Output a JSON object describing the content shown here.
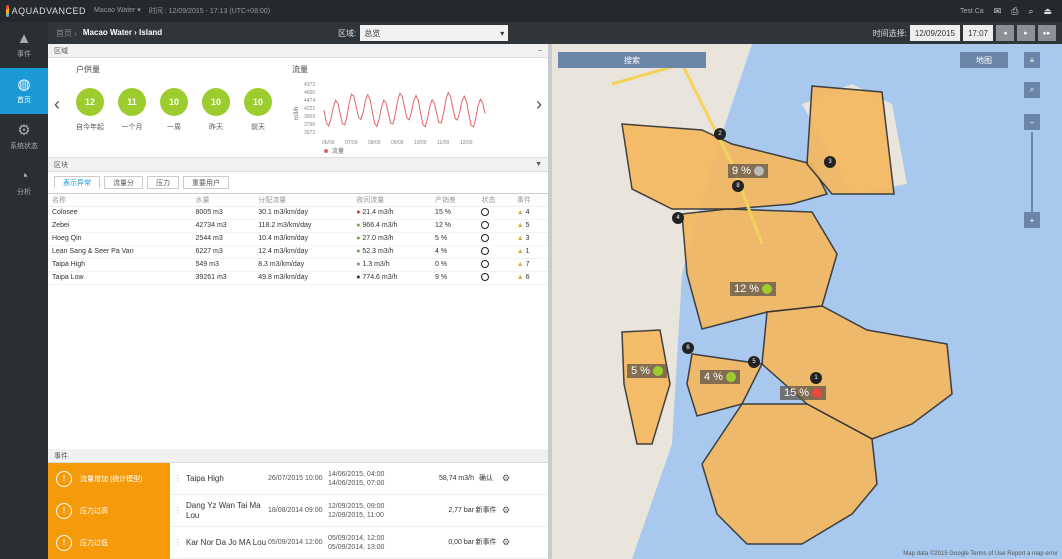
{
  "topbar": {
    "brand": "AQUADVANCED",
    "site": "Macao Water ▾",
    "datetime": "时间 : 12/09/2015 - 17:13 (UTC+08:00)",
    "user": "Test Ca"
  },
  "sidebar": {
    "items": [
      {
        "label": "事件",
        "icon": "warning-icon"
      },
      {
        "label": "首页",
        "icon": "globe-icon"
      },
      {
        "label": "系统状态",
        "icon": "gear-icon"
      },
      {
        "label": "分析",
        "icon": "chart-icon"
      }
    ]
  },
  "toolbar": {
    "home": "首页 ›",
    "breadcrumb": "Macao Water › Island",
    "region_label": "区域:",
    "region_value": "总览",
    "time_label": "时间选择:",
    "date": "12/09/2015",
    "time": "17:07"
  },
  "summary": {
    "panel_title": "区域",
    "consumers_title": "户供量",
    "flow_title": "流量",
    "flow_legend": "流量",
    "flow_axis": "m3/h",
    "flow_ticks": [
      "4373",
      "4600",
      "4474",
      "4221",
      "3009",
      "3796",
      "3573"
    ],
    "flow_dates": [
      "06/09",
      "07/09",
      "08/09",
      "09/09",
      "10/09",
      "11/09",
      "12/09"
    ],
    "circles": [
      {
        "value": "12",
        "label": "自今年起"
      },
      {
        "value": "11",
        "label": "一个月"
      },
      {
        "value": "10",
        "label": "一周"
      },
      {
        "value": "10",
        "label": "昨天"
      },
      {
        "value": "10",
        "label": "前天"
      }
    ]
  },
  "list": {
    "panel_title": "区块",
    "tabs": [
      "表示异常",
      "流量分",
      "压力",
      "重要用户"
    ],
    "headers": [
      "名称",
      "水量",
      "分配流量",
      "夜间流量",
      "产销差",
      "状态",
      "事件"
    ],
    "rows": [
      {
        "name": "Colosee",
        "vol": "8005 m3",
        "dist": "30.1 m3/km/day",
        "night": "21.4 m3/h",
        "night_status": "red",
        "loss": "15 %",
        "events": "4"
      },
      {
        "name": "Zebei",
        "vol": "42734 m3",
        "dist": "118.2 m3/km/day",
        "night": "966.4 m3/h",
        "night_status": "green",
        "loss": "12 %",
        "events": "5"
      },
      {
        "name": "Hoeg Qin",
        "vol": "2544 m3",
        "dist": "10.4 m3/km/day",
        "night": "27.0 m3/h",
        "night_status": "green",
        "loss": "5 %",
        "events": "3"
      },
      {
        "name": "Lean Sang & Seer Pa Van",
        "vol": "6227 m3",
        "dist": "12.4 m3/km/day",
        "night": "52.3 m3/h",
        "night_status": "green",
        "loss": "4 %",
        "events": "1"
      },
      {
        "name": "Taipa High",
        "vol": "549 m3",
        "dist": "8.3 m3/km/day",
        "night": "1.3 m3/h",
        "night_status": "green",
        "loss": "0 %",
        "events": "7"
      },
      {
        "name": "Taipa Low",
        "vol": "39261 m3",
        "dist": "49.8 m3/km/day",
        "night": "774.6 m3/h",
        "night_status": "grey",
        "loss": "9 %",
        "events": "6"
      }
    ]
  },
  "events": {
    "panel_title": "事件",
    "rows": [
      {
        "type": "流量增加 (统计模型)",
        "name": "Taipa High",
        "t1": "26/07/2015 10:00",
        "t2a": "14/06/2015, 04:00",
        "t2b": "14/06/2015, 07:00",
        "val": "58,74 m3/h",
        "status": "确认"
      },
      {
        "type": "压力过高",
        "name": "Dang Yz Wan Tai Ma Lou",
        "t1": "18/08/2014 09:00",
        "t2a": "12/09/2015, 09:00",
        "t2b": "12/09/2015, 11:00",
        "val": "2,77 bar",
        "status": "新事件"
      },
      {
        "type": "压力过低",
        "name": "Kar Nor Da Jo MA Lou",
        "t1": "05/09/2014 12:00",
        "t2a": "05/09/2014, 12:00",
        "t2b": "05/09/2014, 13:00",
        "val": "0,00 bar",
        "status": "新事件"
      }
    ]
  },
  "map": {
    "search_label": "搜索",
    "layers_label": "地图",
    "footer": "Map data ©2015 Google  Terms of Use  Report a map error",
    "zones": [
      {
        "pct": "9 %",
        "status": "grey"
      },
      {
        "pct": "12 %",
        "status": "green"
      },
      {
        "pct": "5 %",
        "status": "green"
      },
      {
        "pct": "4 %",
        "status": "green"
      },
      {
        "pct": "15 %",
        "status": "red"
      }
    ],
    "nodes": [
      "2",
      "3",
      "4",
      "5",
      "6",
      "1",
      "8"
    ]
  },
  "colors": {
    "accent": "#1b9ad6",
    "zone": "#f6b860",
    "alert": "#f59b0b",
    "ok": "#9ccc2e",
    "bad": "#e84a3c"
  }
}
